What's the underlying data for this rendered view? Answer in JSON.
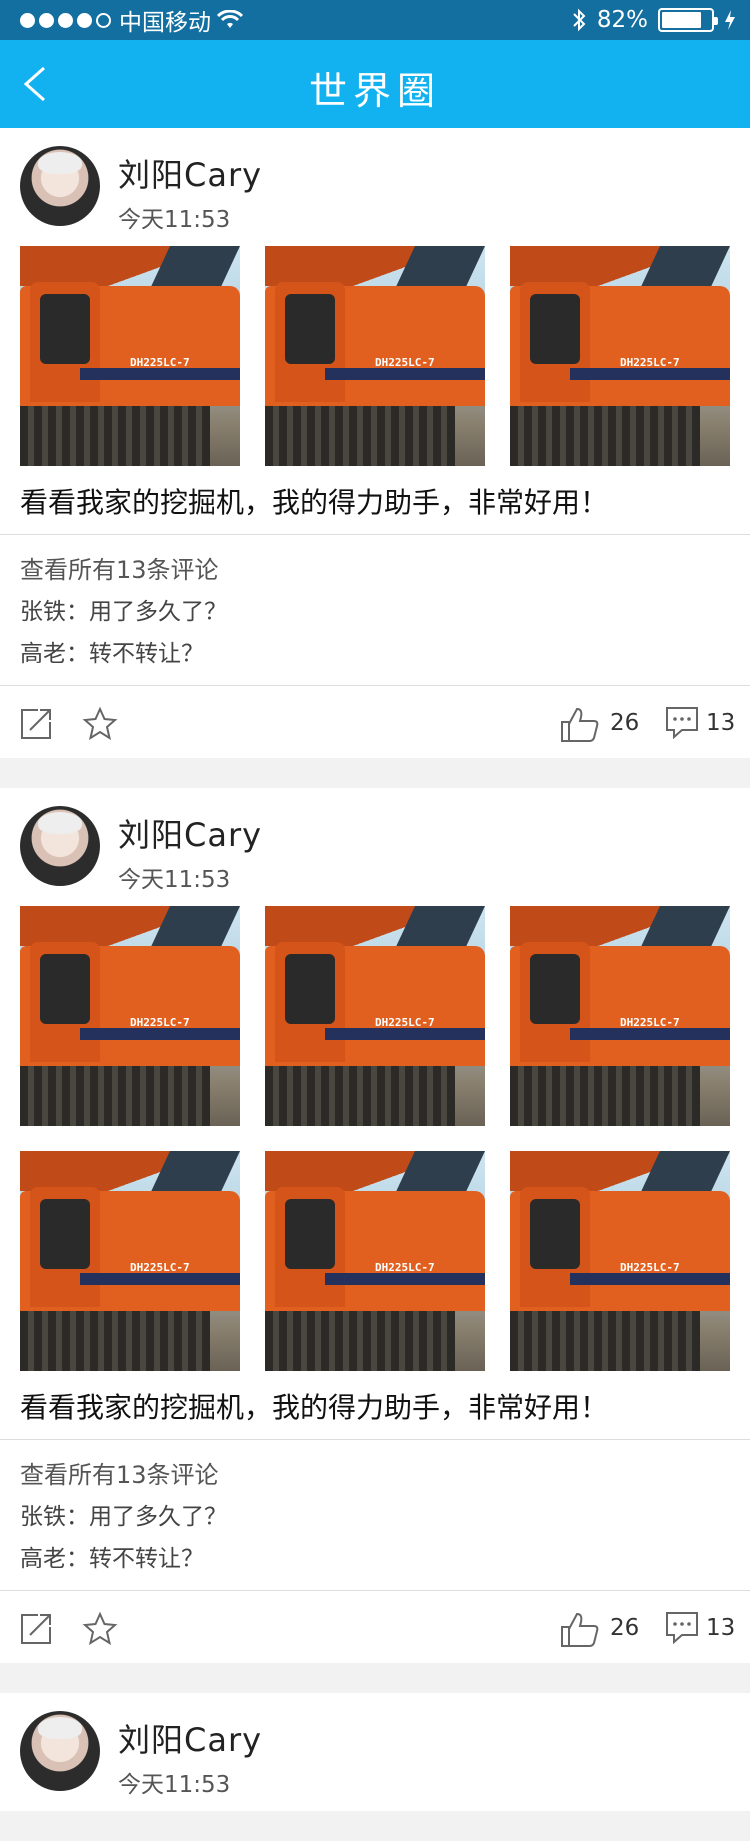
{
  "status_bar": {
    "carrier": "中国移动",
    "battery": "82%",
    "battery_level": 0.82
  },
  "nav": {
    "title": "世界圈"
  },
  "posts": [
    {
      "author": "刘阳Cary",
      "time": "今天11:53",
      "photo_count": 3,
      "photo_label": "DH225LC-7",
      "caption": "看看我家的挖掘机，我的得力助手，非常好用！",
      "view_all": "查看所有13条评论",
      "comments": [
        "张铁：用了多久了？",
        "高老：转不转让？"
      ],
      "likes": "26",
      "comment_count": "13"
    },
    {
      "author": "刘阳Cary",
      "time": "今天11:53",
      "photo_count": 6,
      "photo_label": "DH225LC-7",
      "caption": "看看我家的挖掘机，我的得力助手，非常好用！",
      "view_all": "查看所有13条评论",
      "comments": [
        "张铁：用了多久了？",
        "高老：转不转让？"
      ],
      "likes": "26",
      "comment_count": "13"
    },
    {
      "author": "刘阳Cary",
      "time": "今天11:53"
    }
  ],
  "colors": {
    "status_bar": "#136fa0",
    "nav_bar": "#12b1ef"
  }
}
